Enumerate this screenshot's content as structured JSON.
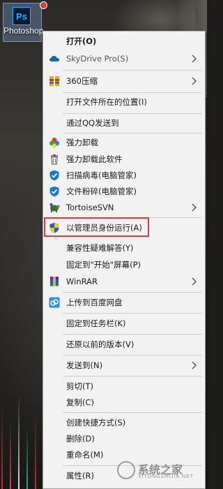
{
  "desktop": {
    "icon_label": "Photoshop",
    "icon_glyph": "Ps",
    "accent": "#31a8ff"
  },
  "menu": {
    "items": [
      {
        "label": "打开(O)",
        "bold": true
      },
      {
        "label": "SkyDrive Pro(S)",
        "icon": "cloud-icon",
        "submenu": true,
        "dim": true
      },
      {
        "label": "360压缩",
        "icon": "archive-360-icon",
        "submenu": true
      },
      {
        "label": "打开文件所在的位置(I)"
      },
      {
        "label": "通过QQ发送到"
      },
      {
        "label": "强力卸载",
        "icon": "clover-icon"
      },
      {
        "label": "强力卸载此软件",
        "icon": "trash-icon"
      },
      {
        "label": "扫描病毒(电脑管家)",
        "icon": "shield-check-icon"
      },
      {
        "label": "文件粉碎(电脑管家)",
        "icon": "shield-check-icon"
      },
      {
        "label": "TortoiseSVN",
        "icon": "tortoise-icon",
        "submenu": true
      },
      {
        "label": "以管理员身份运行(A)",
        "icon": "uac-shield-icon",
        "highlighted": true
      },
      {
        "label": "兼容性疑难解答(Y)"
      },
      {
        "label": "固定到\"开始\"屏幕(P)"
      },
      {
        "label": "WinRAR",
        "icon": "winrar-icon",
        "submenu": true
      },
      {
        "label": "上传到百度网盘",
        "icon": "baidu-cloud-icon"
      },
      {
        "label": "固定到任务栏(K)"
      },
      {
        "label": "还原以前的版本(V)"
      },
      {
        "label": "发送到(N)",
        "submenu": true
      },
      {
        "label": "剪切(T)"
      },
      {
        "label": "复制(C)"
      },
      {
        "label": "创建快捷方式(S)"
      },
      {
        "label": "删除(D)"
      },
      {
        "label": "重命名(M)"
      },
      {
        "label": "属性(R)"
      }
    ],
    "highlight_color": "#e23b3b"
  },
  "watermark": {
    "text": "系统之家",
    "sub": "XITONGZHIJIA.NET"
  }
}
